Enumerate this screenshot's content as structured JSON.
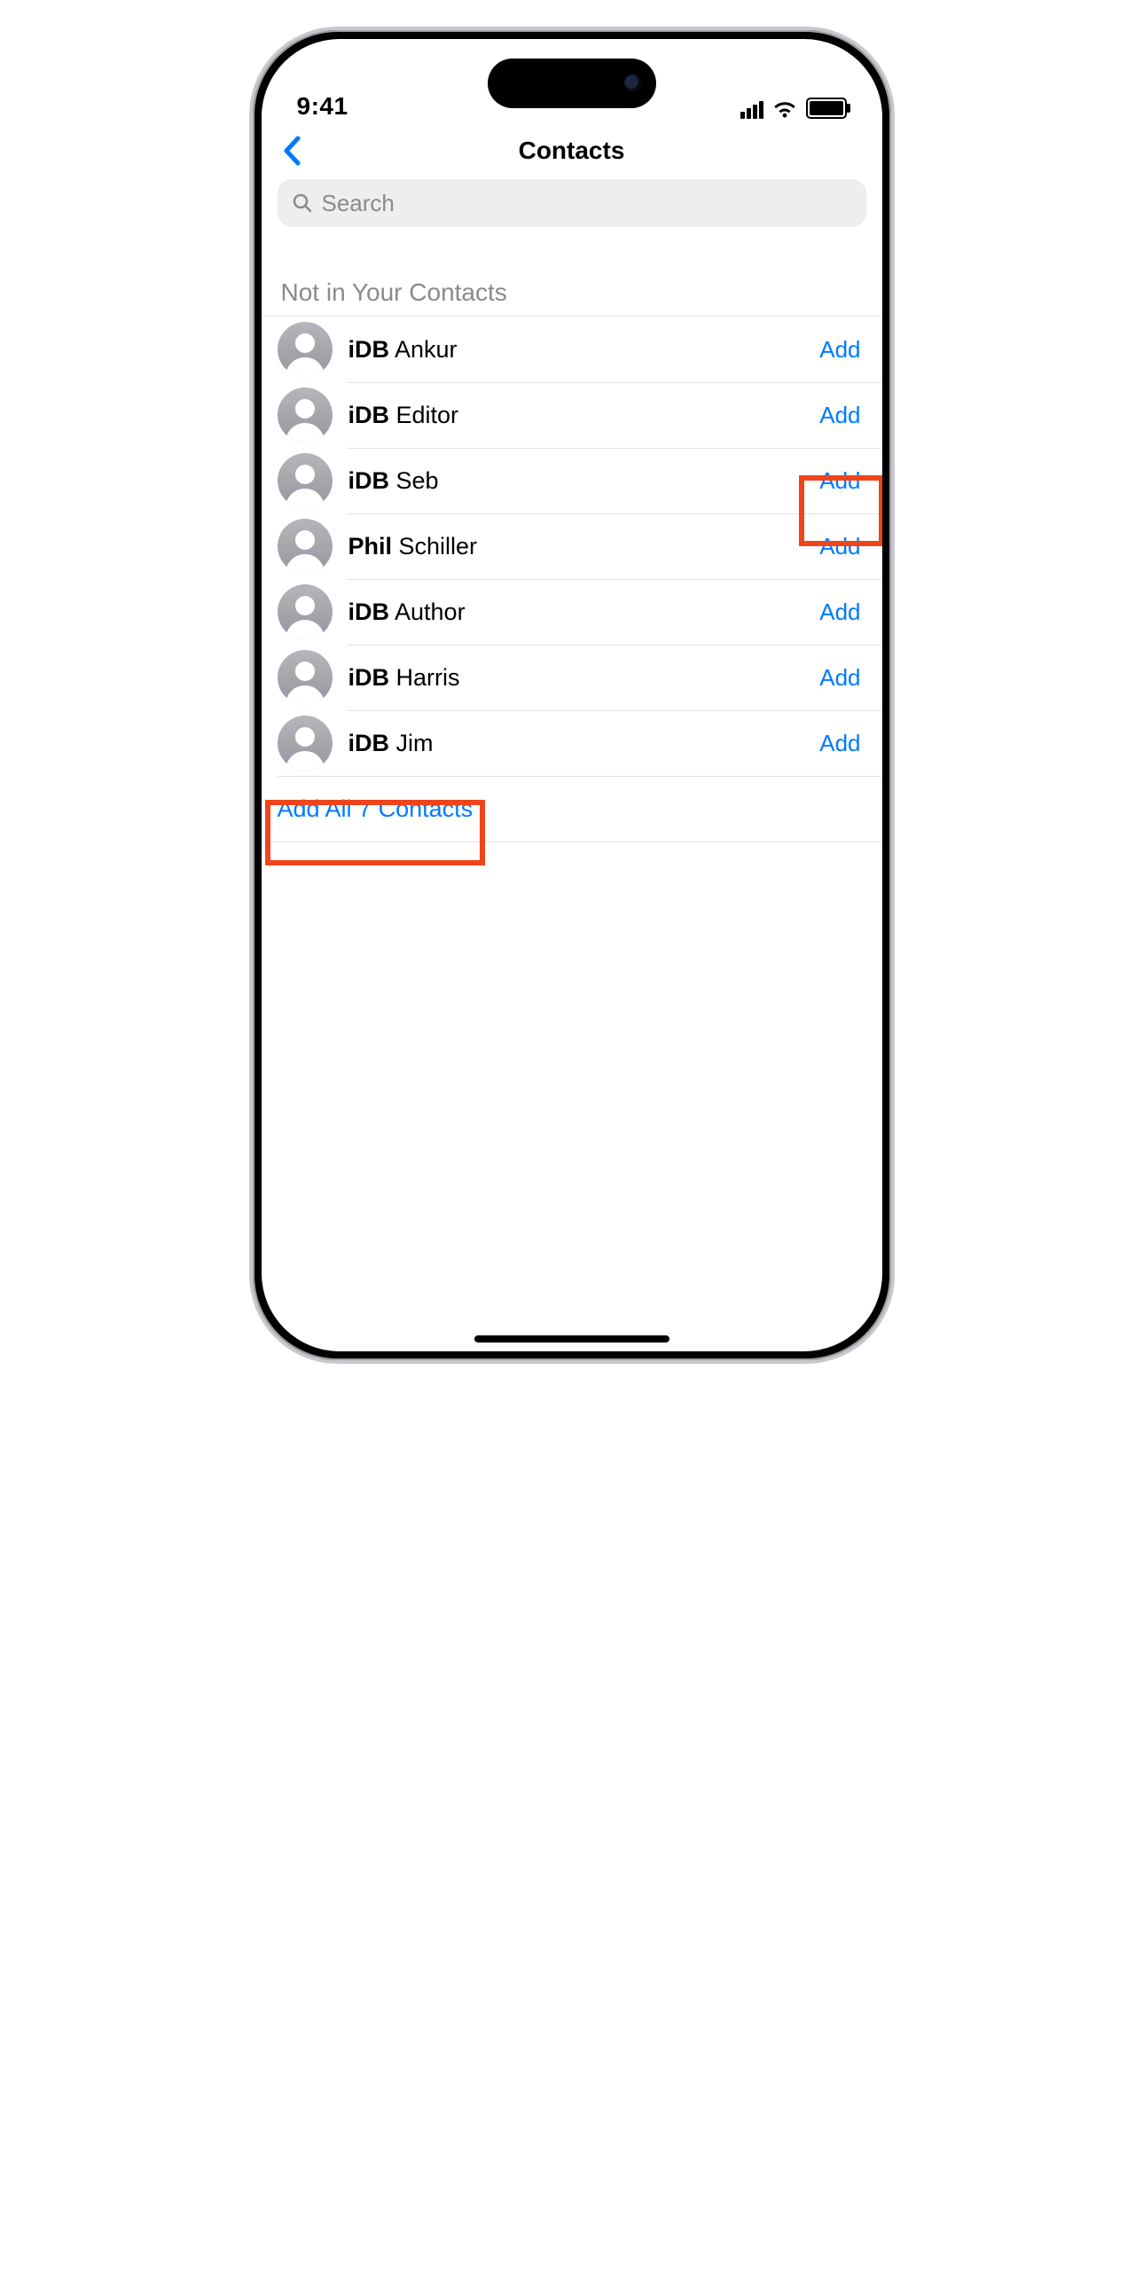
{
  "status": {
    "time": "9:41"
  },
  "nav": {
    "title": "Contacts"
  },
  "search": {
    "placeholder": "Search"
  },
  "section": {
    "header": "Not in Your Contacts"
  },
  "contacts": [
    {
      "bold": "iDB",
      "rest": " Ankur",
      "action": "Add"
    },
    {
      "bold": "iDB",
      "rest": " Editor",
      "action": "Add"
    },
    {
      "bold": "iDB",
      "rest": " Seb",
      "action": "Add"
    },
    {
      "bold": "Phil",
      "rest": " Schiller",
      "action": "Add"
    },
    {
      "bold": "iDB",
      "rest": " Author",
      "action": "Add"
    },
    {
      "bold": "iDB",
      "rest": " Harris",
      "action": "Add"
    },
    {
      "bold": "iDB",
      "rest": " Jim",
      "action": "Add"
    }
  ],
  "add_all": {
    "label": "Add All 7 Contacts"
  },
  "colors": {
    "link": "#007aff",
    "highlight": "#f0451b"
  }
}
